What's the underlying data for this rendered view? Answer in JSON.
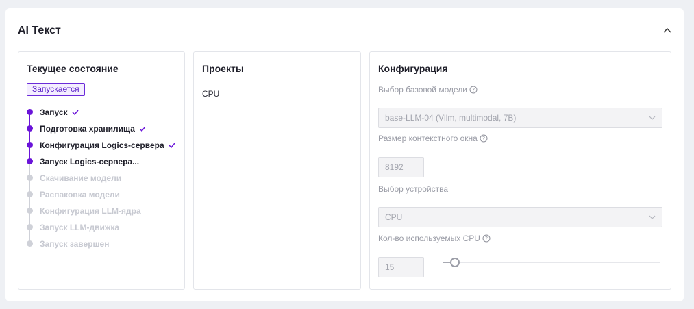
{
  "card": {
    "title": "AI Текст",
    "collapse_icon": "chevron-up-icon"
  },
  "status_panel": {
    "title": "Текущее состояние",
    "badge": "Запускается",
    "steps": [
      {
        "label": "Запуск",
        "state": "done",
        "checked": true
      },
      {
        "label": "Подготовка хранилища",
        "state": "done",
        "checked": true
      },
      {
        "label": "Конфигурация Logics-сервера",
        "state": "done",
        "checked": true
      },
      {
        "label": "Запуск Logics-сервера...",
        "state": "done",
        "checked": false
      },
      {
        "label": "Скачивание модели",
        "state": "pending",
        "checked": false
      },
      {
        "label": "Распаковка модели",
        "state": "pending",
        "checked": false
      },
      {
        "label": "Конфигурация LLM-ядра",
        "state": "pending",
        "checked": false
      },
      {
        "label": "Запуск LLM-движка",
        "state": "pending",
        "checked": false
      },
      {
        "label": "Запуск завершен",
        "state": "pending",
        "checked": false
      }
    ]
  },
  "projects_panel": {
    "title": "Проекты",
    "items": [
      "CPU"
    ]
  },
  "config_panel": {
    "title": "Конфигурация",
    "model_label": "Выбор базовой модели",
    "model_value": "base-LLM-04 (Vllm, multimodal, 7B)",
    "context_label": "Размер контекстного окна",
    "context_value": "8192",
    "device_label": "Выбор устройства",
    "device_value": "CPU",
    "cpu_label": "Кол-во используемых CPU",
    "cpu_value": "15",
    "cpu_slider_fraction": 0.03
  },
  "colors": {
    "accent": "#6a14d9",
    "pending": "#cfd1d8"
  }
}
